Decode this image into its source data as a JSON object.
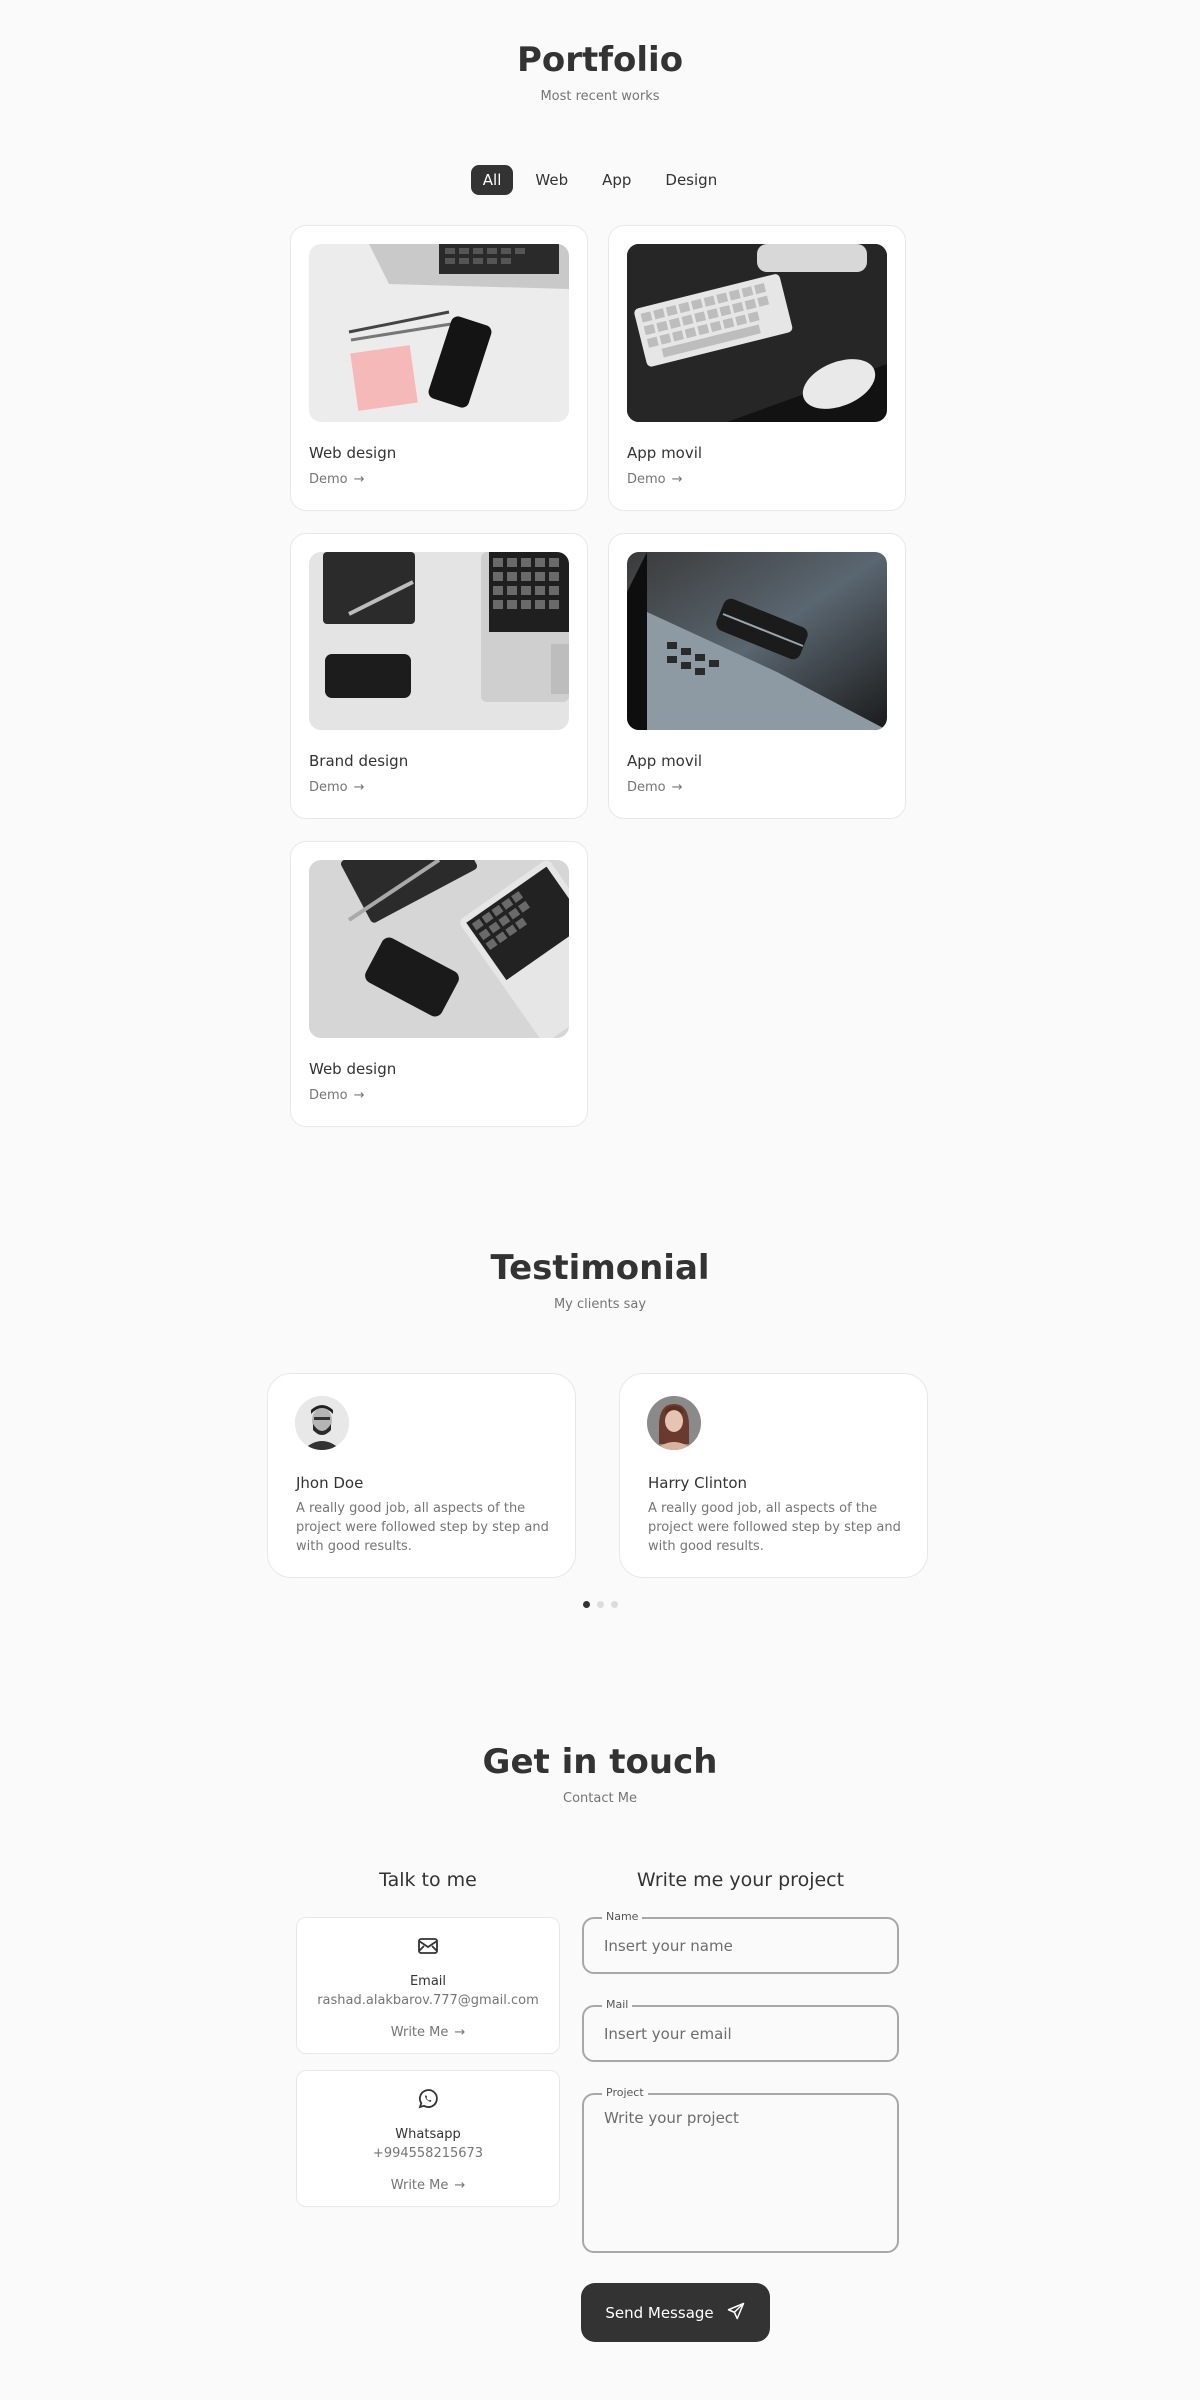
{
  "portfolio": {
    "title": "Portfolio",
    "subtitle": "Most recent works",
    "filters": [
      "All",
      "Web",
      "App",
      "Design"
    ],
    "active_filter": "All",
    "works": [
      {
        "title": "Web design",
        "link": "Demo"
      },
      {
        "title": "App movil",
        "link": "Demo"
      },
      {
        "title": "Brand design",
        "link": "Demo"
      },
      {
        "title": "App movil",
        "link": "Demo"
      },
      {
        "title": "Web design",
        "link": "Demo"
      }
    ]
  },
  "testimonial": {
    "title": "Testimonial",
    "subtitle": "My clients say",
    "items": [
      {
        "name": "Jhon Doe",
        "text": "A really good job, all aspects of the project were followed step by step and with good results."
      },
      {
        "name": "Harry Clinton",
        "text": "A really good job, all aspects of the project were followed step by step and with good results."
      }
    ],
    "active_slide": 1,
    "slide_count": 3
  },
  "contact": {
    "title": "Get in touch",
    "subtitle": "Contact Me",
    "talk_heading": "Talk to me",
    "write_heading": "Write me your project",
    "cards": [
      {
        "label": "Email",
        "value": "rashad.alakbarov.777@gmail.com",
        "link": "Write Me",
        "icon": "mail-icon"
      },
      {
        "label": "Whatsapp",
        "value": "+994558215673",
        "link": "Write Me",
        "icon": "whatsapp-icon"
      }
    ],
    "form": {
      "name_label": "Name",
      "name_placeholder": "Insert your name",
      "mail_label": "Mail",
      "mail_placeholder": "Insert your email",
      "project_label": "Project",
      "project_placeholder": "Write your project",
      "send_label": "Send Message"
    }
  },
  "colors": {
    "accent": "#333333",
    "text_muted": "#757575",
    "background": "#fafafa"
  }
}
